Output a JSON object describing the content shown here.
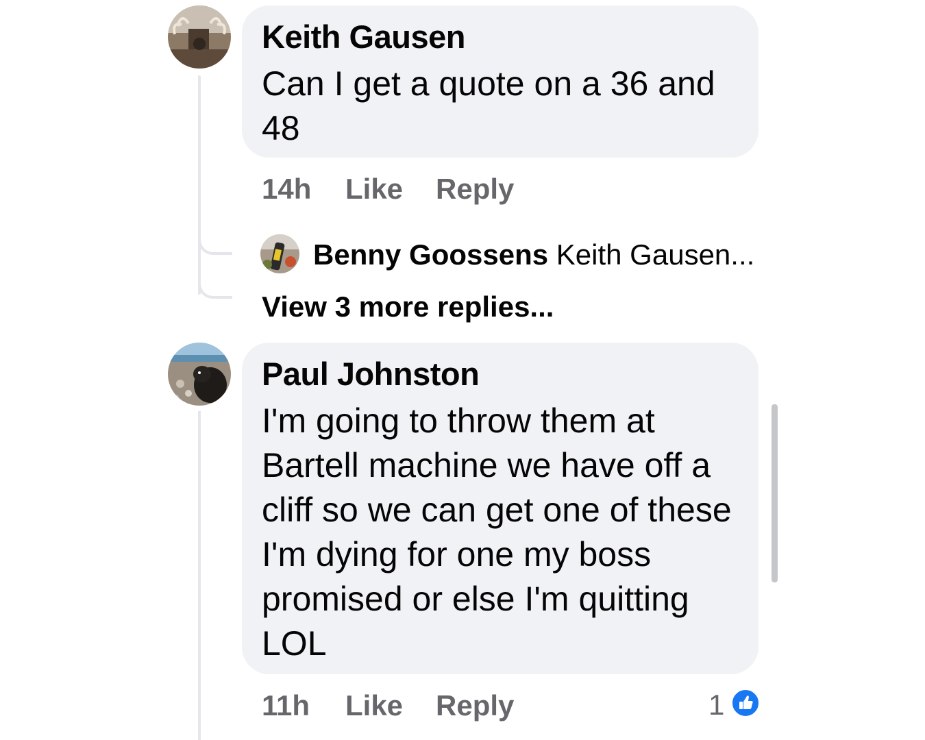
{
  "comments": [
    {
      "author": "Keith Gausen",
      "text": "Can I get a quote on a 36 and 48",
      "time": "14h",
      "like_label": "Like",
      "reply_label": "Reply",
      "avatar_icon": "profile-photo-antlers"
    },
    {
      "author": "Paul Johnston",
      "text": "I'm going to throw them at Bartell machine we have off a cliff so we can get one of these I'm dying for one my boss promised or else I'm quitting LOL",
      "time": "11h",
      "like_label": "Like",
      "reply_label": "Reply",
      "reaction_count": "1",
      "reaction_icon": "like-thumb-icon",
      "avatar_icon": "profile-photo-dog-beach"
    }
  ],
  "reply_preview": {
    "author": "Benny Goossens",
    "snippet": "Keith Gausen...",
    "avatar_icon": "profile-photo-object"
  },
  "view_more_label": "View 3 more replies...",
  "colors": {
    "bubble": "#f0f2f5",
    "meta_text": "#65676b",
    "like_blue": "#1877f2",
    "thread_line": "#e4e6eb"
  }
}
